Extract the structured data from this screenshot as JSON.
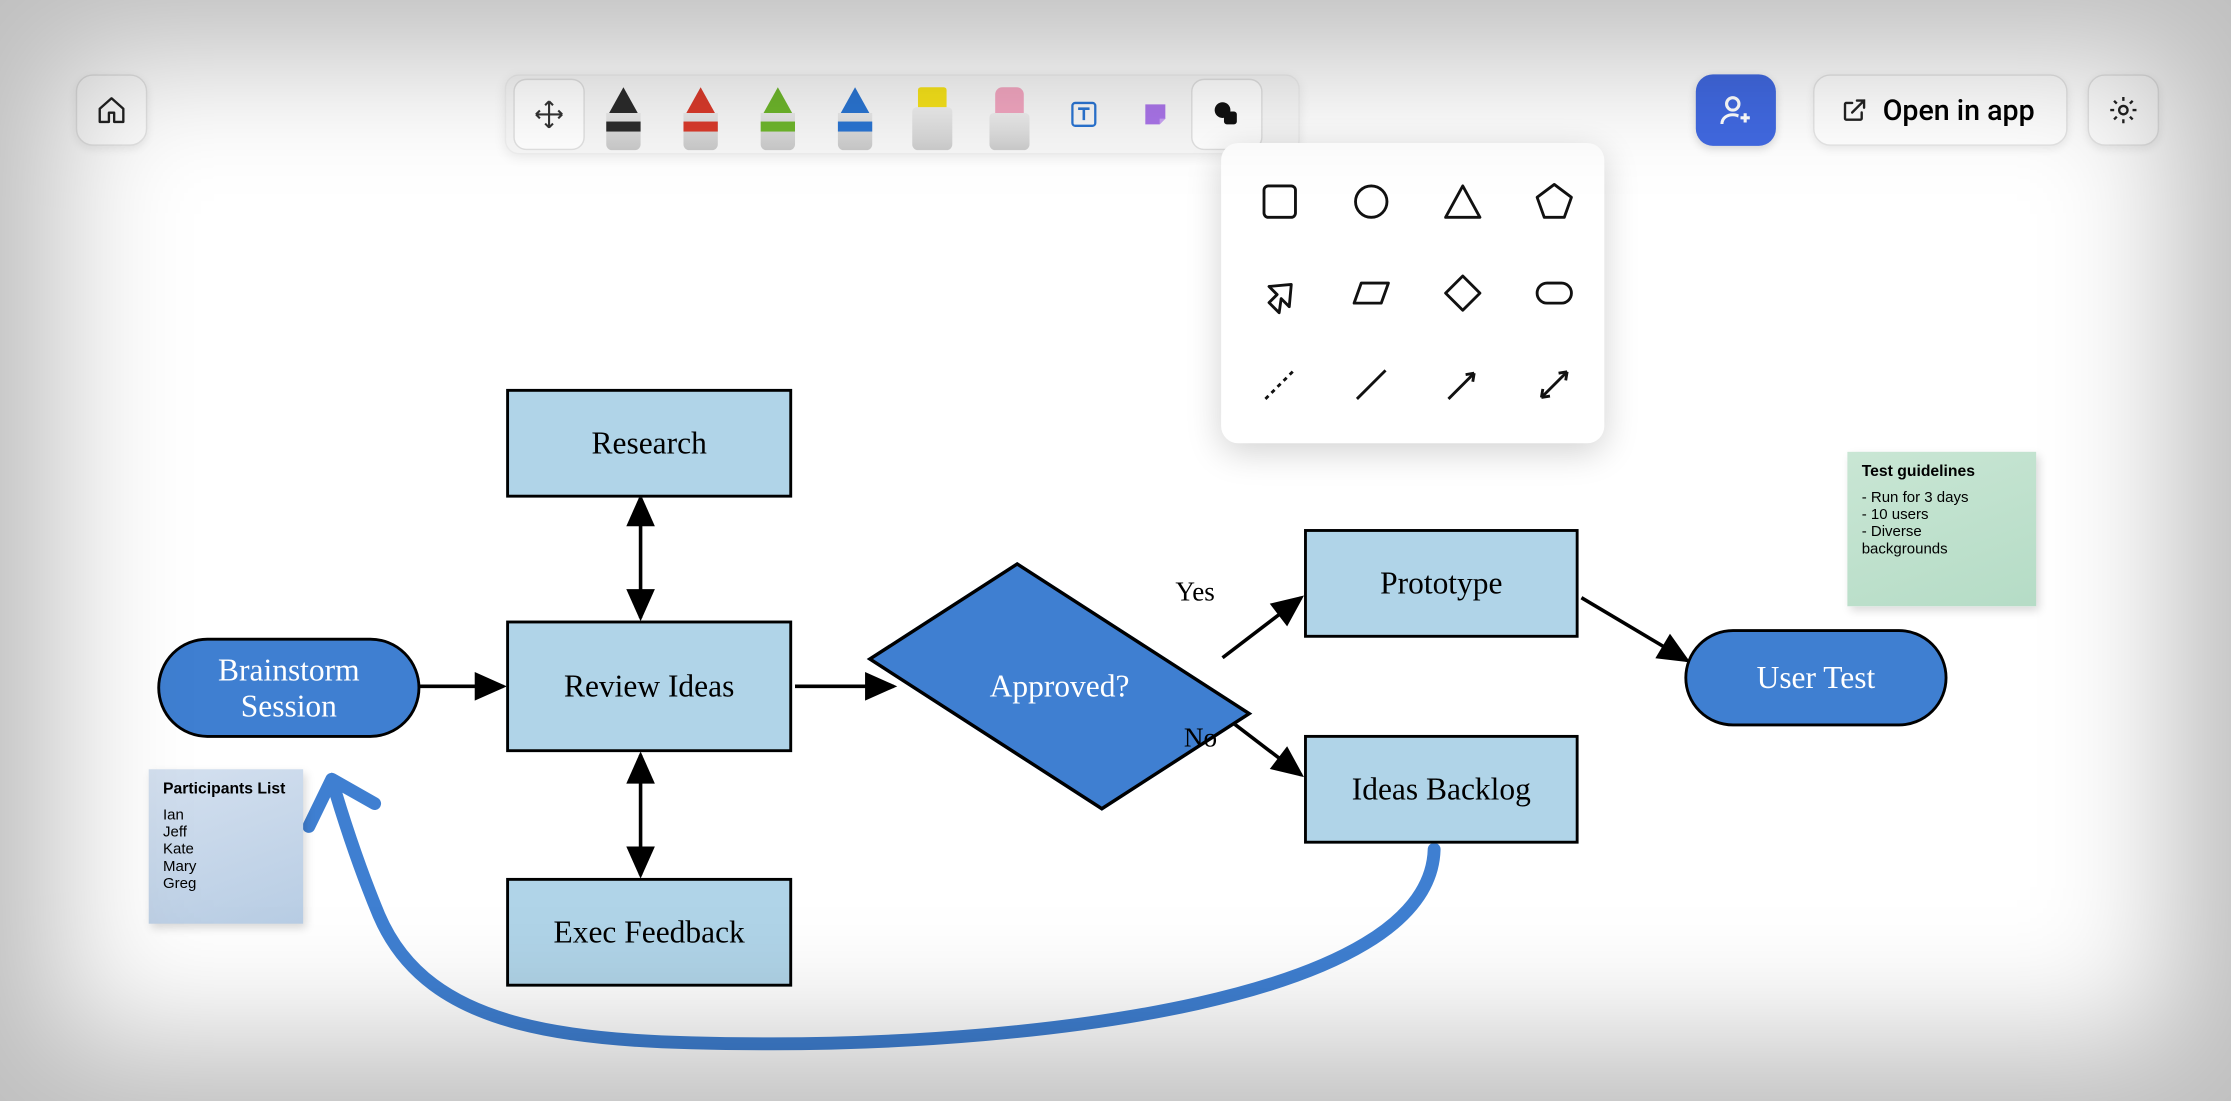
{
  "header": {
    "open_in_app_label": "Open in app"
  },
  "toolbar": {
    "tools": [
      "move",
      "pen-black",
      "pen-red",
      "pen-green",
      "pen-blue",
      "highlighter",
      "eraser",
      "text",
      "note",
      "shapes"
    ],
    "pen_colors": {
      "black": "#2b2b2b",
      "red": "#d83a2b",
      "green": "#6db52b",
      "blue": "#2a74d1"
    },
    "highlighter_color": "#f6e21a",
    "eraser_color": "#f2a6c0",
    "shapes_menu": [
      "square",
      "circle",
      "triangle",
      "pentagon",
      "arrow-block",
      "parallelogram",
      "diamond",
      "rounded-rect",
      "line-dashed",
      "line",
      "line-arrow",
      "line-doublearrow"
    ]
  },
  "diagram": {
    "nodes": {
      "brainstorm": "Brainstorm Session",
      "research": "Research",
      "review": "Review Ideas",
      "exec": "Exec Feedback",
      "approved": "Approved?",
      "prototype": "Prototype",
      "backlog": "Ideas Backlog",
      "usertest": "User Test"
    },
    "edge_labels": {
      "yes": "Yes",
      "no": "No"
    }
  },
  "stickies": {
    "participants": {
      "title": "Participants List",
      "items": [
        "Ian",
        "Jeff",
        "Kate",
        "Mary",
        "Greg"
      ]
    },
    "guidelines": {
      "title": "Test guidelines",
      "items": [
        "- Run for 3 days",
        "- 10 users",
        "- Diverse",
        "backgrounds"
      ]
    }
  },
  "colors": {
    "accent": "#4169e1",
    "node_fill_light": "#b0d4e8",
    "node_fill_dark": "#3f7fd1"
  }
}
